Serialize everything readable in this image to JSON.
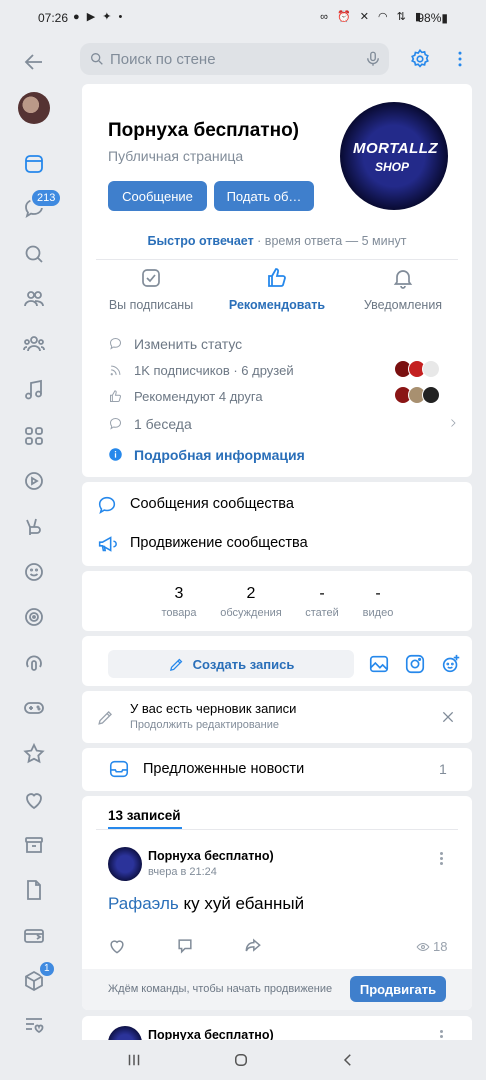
{
  "status_bar": {
    "time": "07:26",
    "left_icons": "● ▶ ✦ •",
    "right_icons": "∞ ⏰ ✕ ◠ ⇅ ▮",
    "battery": "98%▮"
  },
  "rail": {
    "messages_badge": "213",
    "services_badge": "1"
  },
  "search": {
    "placeholder": "Поиск по стене"
  },
  "group": {
    "name": "Порнуха бесплатно)",
    "type": "Публичная страница",
    "cover_line1": "MORTALLZ",
    "cover_line2": "SHOP",
    "message_button": "Сообщение",
    "submit_button": "Подать об…",
    "fast_reply_bold": "Быстро отвечает",
    "fast_reply_rest": " · время ответа — 5 минут"
  },
  "actions": {
    "subscribed": "Вы подписаны",
    "recommend": "Рекомендовать",
    "notifications": "Уведомления"
  },
  "info": {
    "status": "Изменить статус",
    "subscribers": "1K подписчиков · 6 друзей",
    "recommend": "Рекомендуют 4 друга",
    "chats": "1 беседа",
    "details": "Подробная информация"
  },
  "menu": {
    "community_messages": "Сообщения сообщества",
    "promotion": "Продвижение сообщества"
  },
  "counters": [
    {
      "value": "3",
      "label": "товара"
    },
    {
      "value": "2",
      "label": "обсуждения"
    },
    {
      "value": "-",
      "label": "статей"
    },
    {
      "value": "-",
      "label": "видео"
    }
  ],
  "create_post": "Создать запись",
  "draft": {
    "title": "У вас есть черновик записи",
    "subtitle": "Продолжить редактирование"
  },
  "suggested": {
    "label": "Предложенные новости",
    "count": "1"
  },
  "posts_tab": "13 записей",
  "post": {
    "author": "Порнуха бесплатно)",
    "time": "вчера в 21:24",
    "mention": "Рафаэль",
    "text": " ку хуй ебанный",
    "views": "18",
    "promo_text": "Ждём команды, чтобы начать продвижение",
    "promo_button": "Продвигать"
  },
  "post2": {
    "author": "Порнуха бесплатно)"
  },
  "colors": {
    "accent": "#2688eb",
    "button": "#3f7fcc",
    "background": "#ebedf0"
  }
}
